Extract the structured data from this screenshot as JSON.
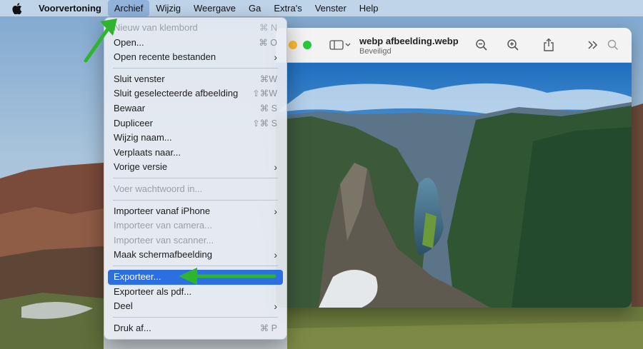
{
  "menubar": {
    "apple_icon": "apple-logo-icon",
    "items": [
      "Voorvertoning",
      "Archief",
      "Wijzig",
      "Weergave",
      "Ga",
      "Extra's",
      "Venster",
      "Help"
    ]
  },
  "window": {
    "title": "webp afbeelding.webp",
    "subtitle": "Beveiligd",
    "icons": [
      "sidebar-icon",
      "zoom-out-icon",
      "zoom-in-icon",
      "share-icon",
      "chevrons-right-icon",
      "search-icon"
    ]
  },
  "menu": {
    "items": [
      {
        "label": "Nieuw van klembord",
        "shortcut": "⌘ N",
        "disabled": true
      },
      {
        "label": "Open...",
        "shortcut": "⌘ O"
      },
      {
        "label": "Open recente bestanden",
        "submenu": true
      },
      {
        "separator": true
      },
      {
        "label": "Sluit venster",
        "shortcut": "⌘W"
      },
      {
        "label": "Sluit geselecteerde afbeelding",
        "shortcut": "⇧⌘W"
      },
      {
        "label": "Bewaar",
        "shortcut": "⌘ S"
      },
      {
        "label": "Dupliceer",
        "shortcut": "⇧⌘ S"
      },
      {
        "label": "Wijzig naam..."
      },
      {
        "label": "Verplaats naar..."
      },
      {
        "label": "Vorige versie",
        "submenu": true
      },
      {
        "separator": true
      },
      {
        "label": "Voer wachtwoord in...",
        "disabled": true
      },
      {
        "separator": true
      },
      {
        "label": "Importeer vanaf iPhone",
        "submenu": true
      },
      {
        "label": "Importeer van camera...",
        "disabled": true
      },
      {
        "label": "Importeer van scanner...",
        "disabled": true
      },
      {
        "label": "Maak schermafbeelding",
        "submenu": true
      },
      {
        "separator": true
      },
      {
        "label": "Exporteer...",
        "highlighted": true
      },
      {
        "label": "Exporteer als pdf..."
      },
      {
        "label": "Deel",
        "submenu": true
      },
      {
        "separator": true
      },
      {
        "label": "Druk af...",
        "shortcut": "⌘ P"
      }
    ]
  },
  "colors": {
    "highlight": "#2c6fe0",
    "annotation_arrow": "#2db52d"
  }
}
